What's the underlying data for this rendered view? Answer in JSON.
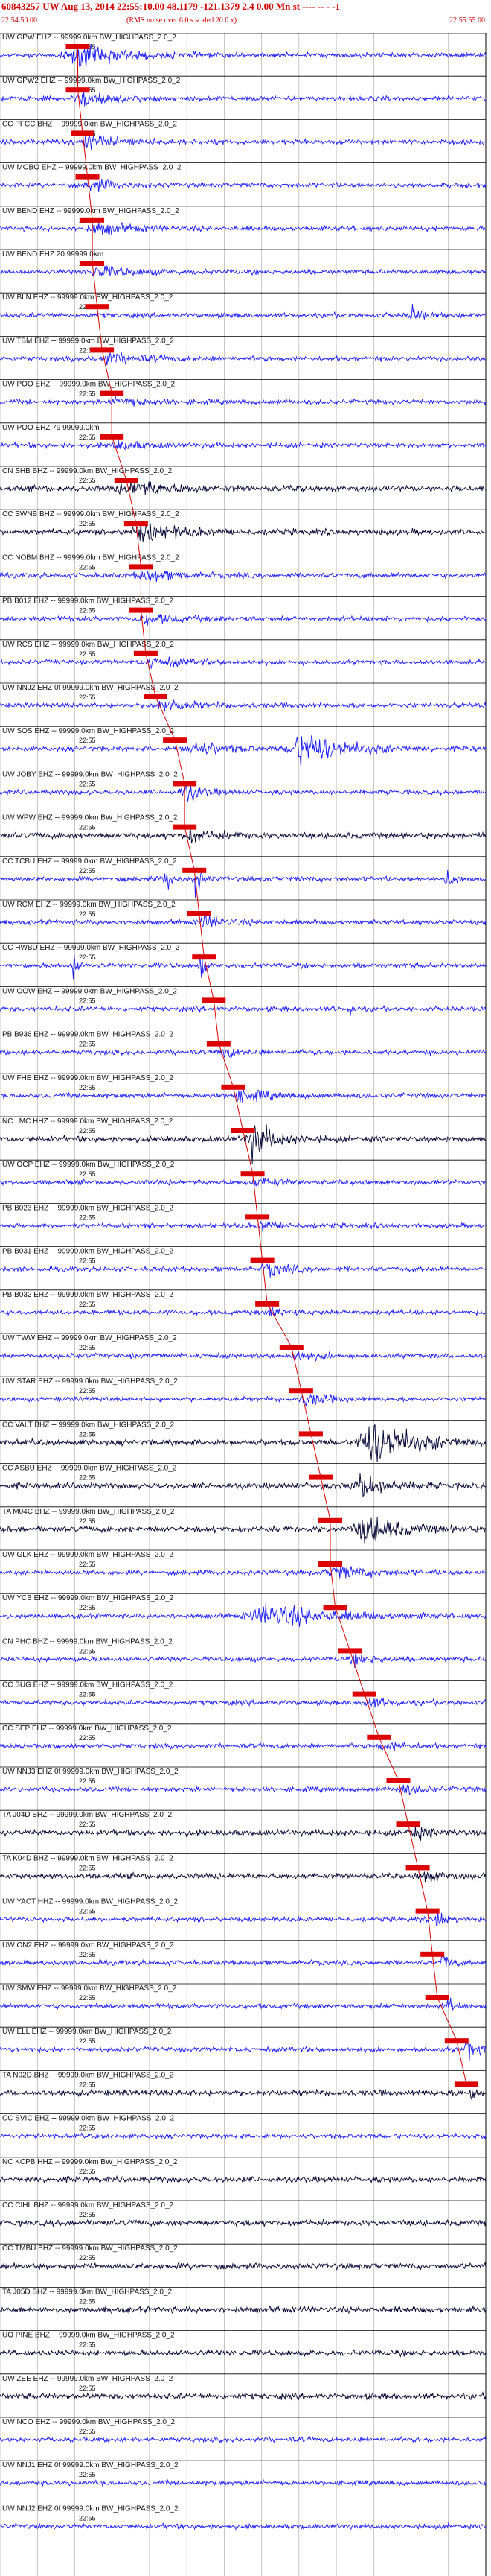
{
  "header": {
    "title": "60843257 UW Aug 13, 2014 22:55:10.00   48.1179 -121.1379  2.4 0.00 Mn st ---- -- - -1",
    "start_time": "22:54:50.00",
    "note": "(RMS noise over 6.0 s scaled 20.0 x)",
    "end_time": "22:55:55.00"
  },
  "colors": {
    "trace_blue": "#1a1aff",
    "trace_dark": "#000033",
    "pick": "#dd0000",
    "grid": "#000000"
  },
  "chart_data": {
    "type": "line",
    "title": "60843257 UW Aug 13, 2014 22:55:10.00   48.1179 -121.1379  2.4 0.00 Mn st ---- -- - -1",
    "time_window": [
      "22:54:50.00",
      "22:55:55.00"
    ],
    "tick_label": "22:55",
    "grid": true,
    "stations": [
      {
        "label": "UW GPW EHZ -- 99999.0km BW_HIGHPASS_2.0_2",
        "color": "blue",
        "pick": 0.16,
        "events": [
          [
            0.16,
            0.12,
            5
          ]
        ]
      },
      {
        "label": "UW GPW2 EHZ -- 99999.0km BW_HIGHPASS_2.0_2",
        "color": "blue",
        "pick": 0.16,
        "events": [
          [
            0.17,
            0.1,
            3
          ]
        ]
      },
      {
        "label": "CC PFCC BHZ -- 99999.0km BW_HIGHPASS_2.0_2",
        "color": "blue",
        "pick": 0.17,
        "events": [
          [
            0.18,
            0.1,
            3
          ]
        ]
      },
      {
        "label": "UW MOBO EHZ -- 99999.0km BW_HIGHPASS_2.0_2",
        "color": "blue",
        "pick": 0.18,
        "events": [
          [
            0.19,
            0.08,
            2.5
          ]
        ]
      },
      {
        "label": "UW BEND EHZ -- 99999.0km BW_HIGHPASS_2.0_2",
        "color": "blue",
        "pick": 0.19,
        "events": [
          [
            0.2,
            0.1,
            2.5
          ]
        ]
      },
      {
        "label": "UW BEND EHZ 20 99999.0km",
        "color": "blue",
        "pick": 0.19,
        "events": [
          [
            0.2,
            0.1,
            2.5
          ]
        ]
      },
      {
        "label": "UW BLN EHZ -- 99999.0km BW_HIGHPASS_2.0_2",
        "color": "blue",
        "pick": 0.2,
        "events": [
          [
            0.85,
            0.02,
            6
          ]
        ]
      },
      {
        "label": "UW TBM EHZ -- 99999.0km BW_HIGHPASS_2.0_2",
        "color": "blue",
        "pick": 0.21,
        "events": [
          [
            0.22,
            0.1,
            2.5
          ]
        ]
      },
      {
        "label": "UW POO EHZ -- 99999.0km BW_HIGHPASS_2.0_2",
        "color": "blue",
        "pick": 0.23,
        "events": [
          [
            0.24,
            0.08,
            2
          ]
        ]
      },
      {
        "label": "UW POO EHZ 79 99999.0km",
        "color": "blue",
        "pick": 0.23,
        "events": [
          [
            0.24,
            0.08,
            2
          ]
        ]
      },
      {
        "label": "CN SHB BHZ -- 99999.0km BW_HIGHPASS_2.0_2",
        "color": "dark",
        "pick": 0.26,
        "events": [
          [
            0.27,
            0.12,
            3
          ]
        ]
      },
      {
        "label": "CC SWNB BHZ -- 99999.0km BW_HIGHPASS_2.0_2",
        "color": "dark",
        "pick": 0.28,
        "events": [
          [
            0.29,
            0.12,
            3
          ]
        ]
      },
      {
        "label": "CC NOBM BHZ -- 99999.0km BW_HIGHPASS_2.0_2",
        "color": "blue",
        "pick": 0.29,
        "events": [
          [
            0.3,
            0.1,
            2.5
          ]
        ]
      },
      {
        "label": "PB B012 EHZ -- 99999.0km BW_HIGHPASS_2.0_2",
        "color": "blue",
        "pick": 0.29,
        "events": [
          [
            0.3,
            0.1,
            2
          ]
        ]
      },
      {
        "label": "UW RCS EHZ -- 99999.0km BW_HIGHPASS_2.0_2",
        "color": "blue",
        "pick": 0.3,
        "events": [
          [
            0.31,
            0.1,
            2
          ]
        ]
      },
      {
        "label": "UW NNJ2 EHZ 0f 99999.0km BW_HIGHPASS_2.0_2",
        "color": "blue",
        "pick": 0.32,
        "events": [
          [
            0.33,
            0.1,
            2.5
          ]
        ]
      },
      {
        "label": "UW SOS EHZ -- 99999.0km BW_HIGHPASS_2.0_2",
        "color": "blue",
        "pick": 0.36,
        "events": [
          [
            0.62,
            0.12,
            8
          ],
          [
            0.4,
            0.1,
            3
          ]
        ]
      },
      {
        "label": "UW JOBY EHZ -- 99999.0km BW_HIGHPASS_2.0_2",
        "color": "blue",
        "pick": 0.38,
        "events": [
          [
            0.38,
            0.05,
            4
          ]
        ]
      },
      {
        "label": "UW WPW EHZ -- 99999.0km BW_HIGHPASS_2.0_2",
        "color": "dark",
        "pick": 0.38,
        "events": [
          [
            0.39,
            0.08,
            2
          ]
        ]
      },
      {
        "label": "CC TCBU EHZ -- 99999.0km BW_HIGHPASS_2.0_2",
        "color": "blue",
        "pick": 0.4,
        "events": [
          [
            0.34,
            0.015,
            9
          ],
          [
            0.4,
            0.015,
            9
          ],
          [
            0.92,
            0.015,
            7
          ]
        ]
      },
      {
        "label": "UW RCM EHZ -- 99999.0km BW_HIGHPASS_2.0_2",
        "color": "blue",
        "pick": 0.41,
        "events": [
          [
            0.42,
            0.06,
            3
          ]
        ]
      },
      {
        "label": "CC HWBU EHZ -- 99999.0km BW_HIGHPASS_2.0_2",
        "color": "blue",
        "pick": 0.42,
        "events": [
          [
            0.15,
            0.01,
            10
          ],
          [
            0.41,
            0.01,
            10
          ]
        ]
      },
      {
        "label": "UW OOW EHZ -- 99999.0km BW_HIGHPASS_2.0_2",
        "color": "blue",
        "pick": 0.44,
        "events": [
          [
            0.72,
            0.01,
            4
          ]
        ]
      },
      {
        "label": "PB B936 EHZ -- 99999.0km BW_HIGHPASS_2.0_2",
        "color": "blue",
        "pick": 0.45,
        "events": [
          [
            0.46,
            0.06,
            2
          ]
        ]
      },
      {
        "label": "UW FHE EHZ -- 99999.0km BW_HIGHPASS_2.0_2",
        "color": "blue",
        "pick": 0.48,
        "events": [
          [
            0.49,
            0.1,
            2.5
          ]
        ]
      },
      {
        "label": "NC LMC HHZ -- 99999.0km BW_HIGHPASS_2.0_2",
        "color": "dark",
        "pick": 0.5,
        "events": [
          [
            0.52,
            0.06,
            7
          ]
        ]
      },
      {
        "label": "UW OCP EHZ -- 99999.0km BW_HIGHPASS_2.0_2",
        "color": "blue",
        "pick": 0.52,
        "events": [
          [
            0.53,
            0.06,
            2
          ]
        ]
      },
      {
        "label": "PB B023 EHZ -- 99999.0km BW_HIGHPASS_2.0_2",
        "color": "blue",
        "pick": 0.53,
        "events": [
          [
            0.54,
            0.06,
            2
          ]
        ]
      },
      {
        "label": "PB B031 EHZ -- 99999.0km BW_HIGHPASS_2.0_2",
        "color": "blue",
        "pick": 0.54,
        "events": [
          [
            0.55,
            0.06,
            3
          ]
        ]
      },
      {
        "label": "PB B032 EHZ -- 99999.0km BW_HIGHPASS_2.0_2",
        "color": "blue",
        "pick": 0.55,
        "events": [
          [
            0.56,
            0.06,
            2
          ]
        ]
      },
      {
        "label": "UW TWW EHZ -- 99999.0km BW_HIGHPASS_2.0_2",
        "color": "blue",
        "pick": 0.6,
        "events": [
          [
            0.61,
            0.06,
            2
          ]
        ]
      },
      {
        "label": "UW STAR EHZ -- 99999.0km BW_HIGHPASS_2.0_2",
        "color": "blue",
        "pick": 0.62,
        "events": [
          [
            0.63,
            0.06,
            3
          ]
        ]
      },
      {
        "label": "CC VALT BHZ -- 99999.0km BW_HIGHPASS_2.0_2",
        "color": "dark",
        "pick": 0.64,
        "events": [
          [
            0.76,
            0.12,
            9
          ]
        ]
      },
      {
        "label": "CC ASBU EHZ -- 99999.0km BW_HIGHPASS_2.0_2",
        "color": "dark",
        "pick": 0.66,
        "events": [
          [
            0.74,
            0.08,
            4
          ]
        ]
      },
      {
        "label": "TA M04C BHZ -- 99999.0km BW_HIGHPASS_2.0_2",
        "color": "dark",
        "pick": 0.68,
        "events": [
          [
            0.75,
            0.1,
            5
          ]
        ]
      },
      {
        "label": "UW GLK EHZ -- 99999.0km BW_HIGHPASS_2.0_2",
        "color": "blue",
        "pick": 0.68,
        "events": [
          [
            0.69,
            0.1,
            3
          ]
        ]
      },
      {
        "label": "UW YCB EHZ -- 99999.0km BW_HIGHPASS_2.0_2",
        "color": "blue",
        "pick": 0.69,
        "events": [
          [
            0.55,
            0.2,
            5
          ]
        ]
      },
      {
        "label": "CN PHC BHZ -- 99999.0km BW_HIGHPASS_2.0_2",
        "color": "blue",
        "pick": 0.72,
        "events": [
          [
            0.73,
            0.06,
            2
          ]
        ]
      },
      {
        "label": "CC SUG EHZ -- 99999.0km BW_HIGHPASS_2.0_2",
        "color": "blue",
        "pick": 0.75,
        "events": [
          [
            0.76,
            0.06,
            2
          ]
        ]
      },
      {
        "label": "CC SEP EHZ -- 99999.0km BW_HIGHPASS_2.0_2",
        "color": "blue",
        "pick": 0.78,
        "events": [
          [
            0.79,
            0.06,
            2
          ]
        ]
      },
      {
        "label": "UW NNJ3 EHZ 0f 99999.0km BW_HIGHPASS_2.0_2",
        "color": "blue",
        "pick": 0.82,
        "events": [
          [
            0.83,
            0.06,
            2
          ]
        ]
      },
      {
        "label": "TA J04D BHZ -- 99999.0km BW_HIGHPASS_2.0_2",
        "color": "dark",
        "pick": 0.84,
        "events": [
          [
            0.85,
            0.06,
            2
          ]
        ]
      },
      {
        "label": "TA K04D BHZ -- 99999.0km BW_HIGHPASS_2.0_2",
        "color": "dark",
        "pick": 0.86,
        "events": [
          [
            0.87,
            0.06,
            2
          ]
        ]
      },
      {
        "label": "UW YACT HHZ -- 99999.0km BW_HIGHPASS_2.0_2",
        "color": "blue",
        "pick": 0.88,
        "events": [
          [
            0.9,
            0.02,
            6
          ]
        ]
      },
      {
        "label": "UW ON2 EHZ -- 99999.0km BW_HIGHPASS_2.0_2",
        "color": "blue",
        "pick": 0.89,
        "events": [
          [
            0.91,
            0.02,
            5
          ]
        ]
      },
      {
        "label": "UW SMW EHZ -- 99999.0km BW_HIGHPASS_2.0_2",
        "color": "blue",
        "pick": 0.9,
        "events": [
          [
            0.92,
            0.02,
            4
          ]
        ]
      },
      {
        "label": "UW ELL EHZ -- 99999.0km BW_HIGHPASS_2.0_2",
        "color": "blue",
        "pick": 0.94,
        "events": [
          [
            0.96,
            0.03,
            5
          ]
        ]
      },
      {
        "label": "TA N02D BHZ -- 99999.0km BW_HIGHPASS_2.0_2",
        "color": "dark",
        "pick": 0.96,
        "events": [
          [
            0.97,
            0.02,
            3
          ]
        ]
      },
      {
        "label": "CC SVIC EHZ -- 99999.0km BW_HIGHPASS_2.0_2",
        "color": "blue",
        "pick": null,
        "events": []
      },
      {
        "label": "NC KCPB HHZ -- 99999.0km BW_HIGHPASS_2.0_2",
        "color": "dark",
        "pick": null,
        "events": []
      },
      {
        "label": "CC CIHL BHZ -- 99999.0km BW_HIGHPASS_2.0_2",
        "color": "dark",
        "pick": null,
        "events": []
      },
      {
        "label": "CC TMBU BHZ -- 99999.0km BW_HIGHPASS_2.0_2",
        "color": "dark",
        "pick": null,
        "events": []
      },
      {
        "label": "TA J05D BHZ -- 99999.0km BW_HIGHPASS_2.0_2",
        "color": "dark",
        "pick": null,
        "events": []
      },
      {
        "label": "UO PINE BHZ -- 99999.0km BW_HIGHPASS_2.0_2",
        "color": "dark",
        "pick": null,
        "events": []
      },
      {
        "label": "UW ZEE EHZ -- 99999.0km BW_HIGHPASS_2.0_2",
        "color": "dark",
        "pick": null,
        "events": []
      },
      {
        "label": "UW NCO EHZ -- 99999.0km BW_HIGHPASS_2.0_2",
        "color": "blue",
        "pick": null,
        "events": []
      },
      {
        "label": "UW NNJ1 EHZ 0f 99999.0km BW_HIGHPASS_2.0_2",
        "color": "blue",
        "pick": null,
        "events": []
      },
      {
        "label": "UW NNJ2 EHZ 0f 99999.0km BW_HIGHPASS_2.0_2",
        "color": "blue",
        "pick": null,
        "events": []
      }
    ]
  }
}
